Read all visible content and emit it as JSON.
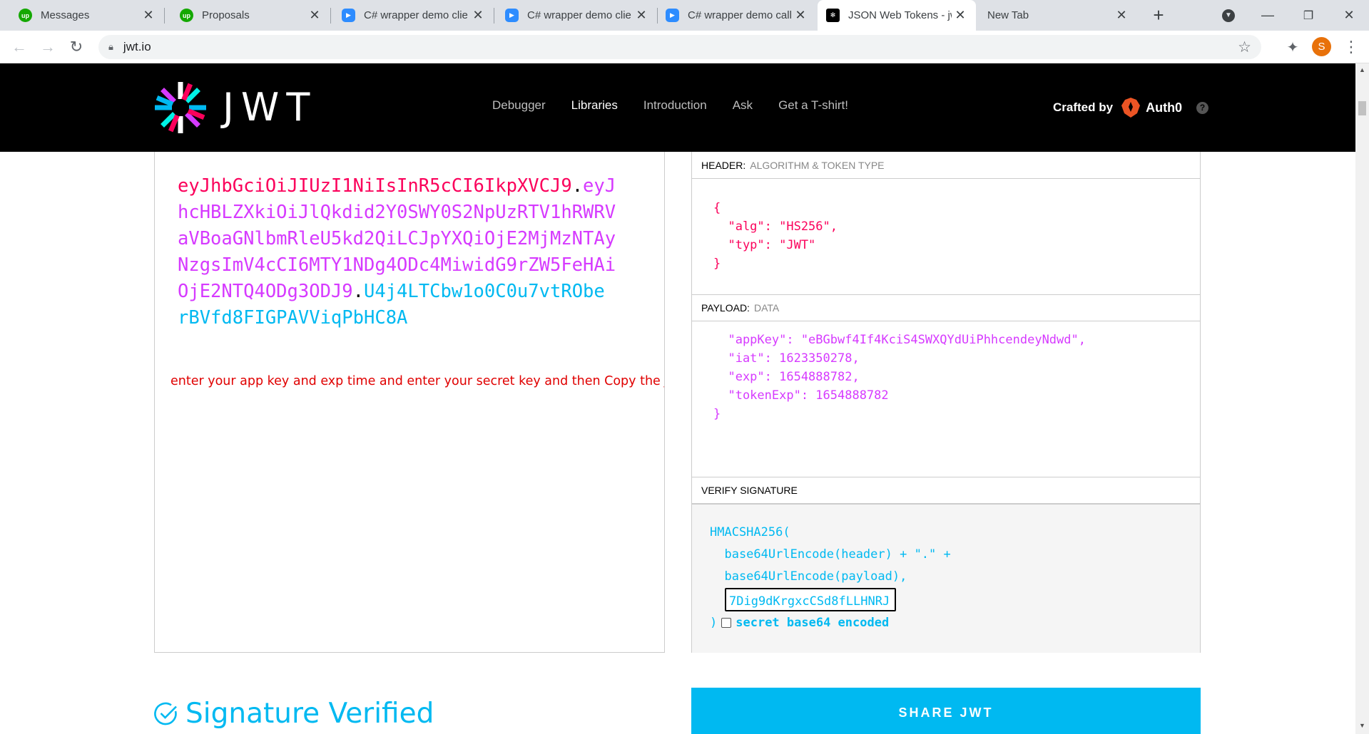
{
  "browser": {
    "tabs": [
      {
        "title": "Messages",
        "favicon": "upwork-icon"
      },
      {
        "title": "Proposals",
        "favicon": "upwork-icon"
      },
      {
        "title": "C# wrapper demo clie",
        "favicon": "zoom-icon"
      },
      {
        "title": "C# wrapper demo clie",
        "favicon": "zoom-icon"
      },
      {
        "title": "C# wrapper demo call",
        "favicon": "zoom-icon"
      },
      {
        "title": "JSON Web Tokens - jw",
        "favicon": "jwt-icon"
      },
      {
        "title": "New Tab",
        "favicon": ""
      }
    ],
    "url": "jwt.io",
    "profile_initial": "S"
  },
  "site": {
    "logo_text": "JWT",
    "nav": [
      "Debugger",
      "Libraries",
      "Introduction",
      "Ask",
      "Get a T-shirt!"
    ],
    "nav_active": "Libraries",
    "crafted_by": "Crafted by",
    "brand": "Auth0",
    "help": "?"
  },
  "encoded": {
    "header_part": "eyJhbGciOiJIUzI1NiIsInR5cCI6IkpXVCJ9",
    "dot1": ".",
    "payload_part": "eyJhcHBLZXkiOiJlQkdid2Y0SWY0S2NpUzRTV1hRWRVaVBoaGNlbmRleU5kd2QiLCJpYXQiOjE2MjMzNTAyNzgsImV4cCI6MTY1NDg4ODc4MiwidG9rZW5FeHAiOjE2NTQ4ODg3ODJ9",
    "dot2": ".",
    "signature_part": "U4j4LTCbw1o0C0u7vtRObe rBVfd8FIGPAVViqPbHC8A",
    "hint": "enter your app key and exp time and enter your secret key and then Copy the JWT token"
  },
  "decoded": {
    "header": {
      "title": "HEADER:",
      "subtitle": "ALGORITHM & TOKEN TYPE",
      "lines": [
        "{",
        "  \"alg\": \"HS256\",",
        "  \"typ\": \"JWT\"",
        "}"
      ]
    },
    "payload": {
      "title": "PAYLOAD:",
      "subtitle": "DATA",
      "lines": [
        "  \"appKey\": \"eBGbwf4If4KciS4SWXQYdUiPhhcendeyNdwd\",",
        "  \"iat\": 1623350278,",
        "  \"exp\": 1654888782,",
        "  \"tokenExp\": 1654888782",
        "}"
      ]
    },
    "signature": {
      "title": "VERIFY SIGNATURE",
      "line1": "HMACSHA256(",
      "line2": "  base64UrlEncode(header) + \".\" +",
      "line3": "  base64UrlEncode(payload),",
      "secret_value": "7Dig9dKrgxcCSd8fLLHNRJ",
      "close": ")",
      "b64_label": "secret base64 encoded"
    }
  },
  "status": {
    "verified_text": "Signature Verified",
    "share_label": "SHARE JWT"
  },
  "colors": {
    "header": "#fb015b",
    "payload": "#d63aff",
    "signature": "#00b9f1"
  }
}
